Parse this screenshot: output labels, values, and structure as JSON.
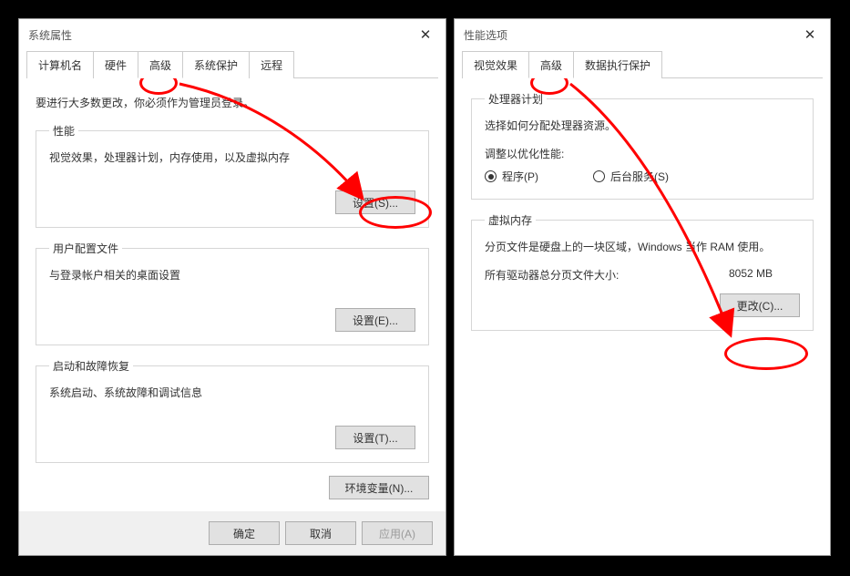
{
  "left": {
    "title": "系统属性",
    "tabs": [
      "计算机名",
      "硬件",
      "高级",
      "系统保护",
      "远程"
    ],
    "active_tab_index": 2,
    "admin_hint": "要进行大多数更改，你必须作为管理员登录。",
    "perf": {
      "legend": "性能",
      "desc": "视觉效果，处理器计划，内存使用，以及虚拟内存",
      "button": "设置(S)..."
    },
    "profiles": {
      "legend": "用户配置文件",
      "desc": "与登录帐户相关的桌面设置",
      "button": "设置(E)..."
    },
    "startup": {
      "legend": "启动和故障恢复",
      "desc": "系统启动、系统故障和调试信息",
      "button": "设置(T)..."
    },
    "env_button": "环境变量(N)...",
    "footer": {
      "ok": "确定",
      "cancel": "取消",
      "apply": "应用(A)"
    }
  },
  "right": {
    "title": "性能选项",
    "tabs": [
      "视觉效果",
      "高级",
      "数据执行保护"
    ],
    "active_tab_index": 1,
    "sched": {
      "legend": "处理器计划",
      "desc": "选择如何分配处理器资源。",
      "adjust_label": "调整以优化性能:",
      "opt_programs": "程序(P)",
      "opt_services": "后台服务(S)",
      "selected": "programs"
    },
    "vm": {
      "legend": "虚拟内存",
      "desc": "分页文件是硬盘上的一块区域，Windows 当作 RAM 使用。",
      "total_label": "所有驱动器总分页文件大小:",
      "total_value": "8052 MB",
      "change_button": "更改(C)..."
    }
  }
}
